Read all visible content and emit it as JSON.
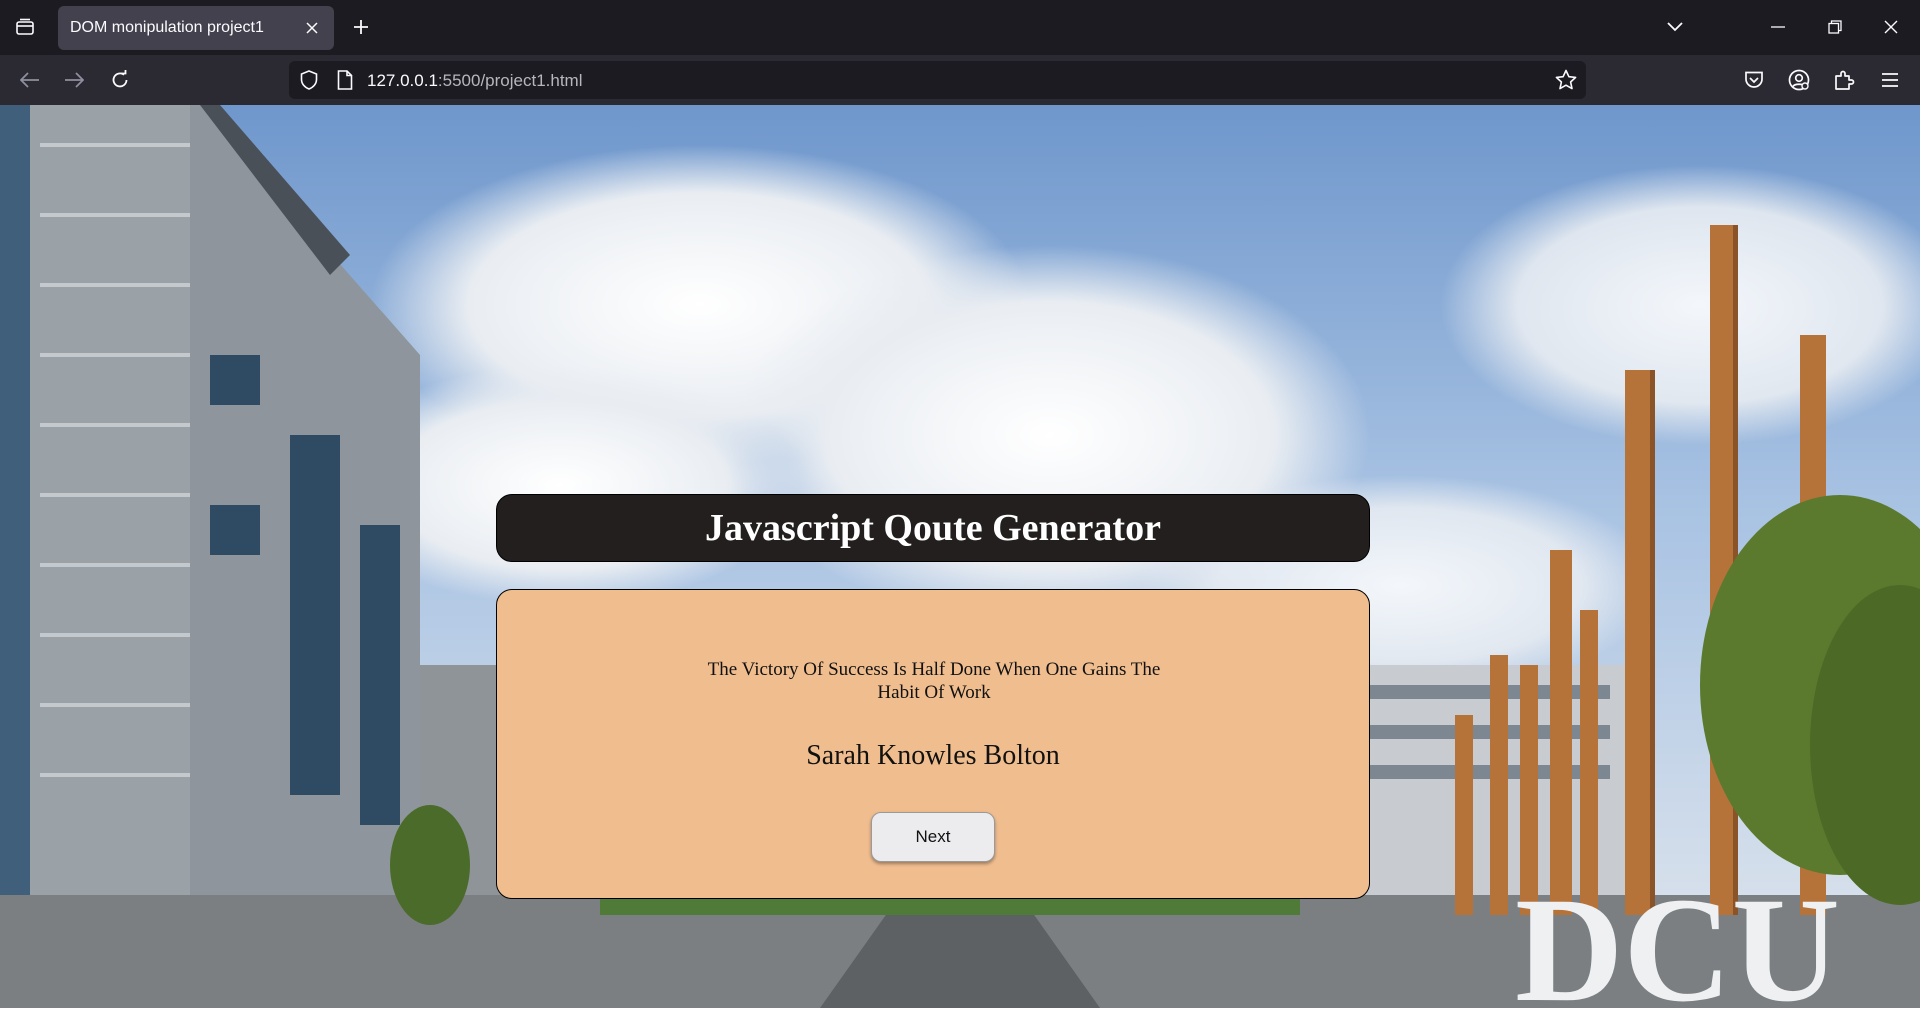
{
  "browser": {
    "tab": {
      "title": "DOM monipulation project1"
    },
    "address": {
      "host": "127.0.0.1",
      "path": ":5500/project1.html"
    }
  },
  "background": {
    "sign_text": "DCU"
  },
  "app": {
    "title": "Javascript Qoute Generator",
    "quote": "The Victory Of Success Is Half Done When One Gains The Habit Of Work",
    "author": "Sarah Knowles Bolton",
    "next_label": "Next"
  },
  "colors": {
    "header_bg": "#221f1e",
    "card_bg": "#f0bd8f",
    "button_bg": "#ececee",
    "chrome_dark": "#1c1b22",
    "chrome_mid": "#2b2a33",
    "tab_active": "#42414d"
  }
}
